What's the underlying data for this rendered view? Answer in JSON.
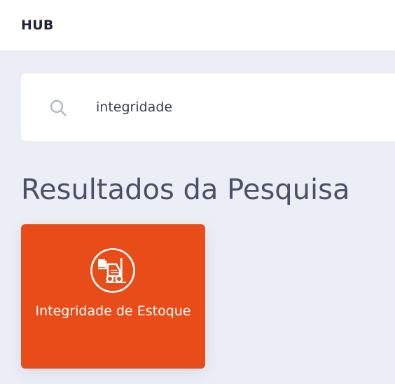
{
  "header": {
    "brand": "HUB"
  },
  "search": {
    "icon": "search-icon",
    "value": "integridade"
  },
  "results": {
    "title": "Resultados da Pesquisa",
    "items": [
      {
        "label": "Integridade de Estoque",
        "icon": "forklift-icon",
        "color": "#e84c18"
      }
    ]
  },
  "colors": {
    "background": "#eceef6",
    "accent": "#e84c18",
    "title": "#4a5067",
    "search_icon": "#b3b8c6"
  }
}
